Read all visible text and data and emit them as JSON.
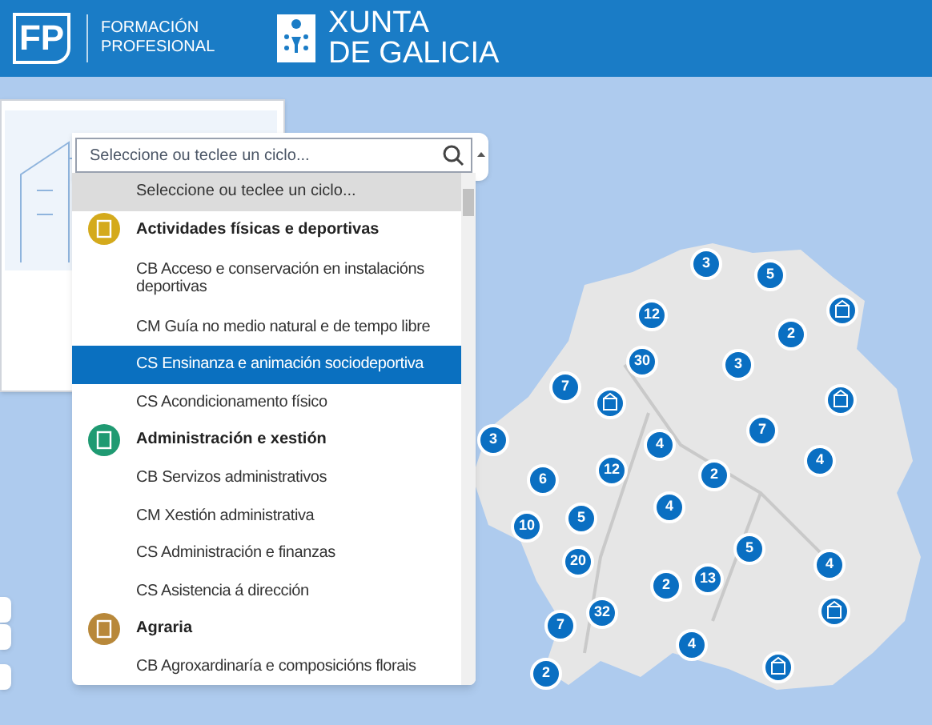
{
  "header": {
    "fp_logo": "FP",
    "fp_text": "FORMACIÓN PROFESIONAL",
    "xunta_line1": "XUNTA",
    "xunta_line2": "DE GALICIA"
  },
  "search": {
    "placeholder": "Seleccione ou teclee un ciclo..."
  },
  "options": [
    {
      "kind": "placeholder",
      "label": "Seleccione ou teclee un ciclo...",
      "selected": false
    },
    {
      "kind": "family",
      "label": "Actividades físicas e deportivas",
      "color": "#d4aa1c"
    },
    {
      "kind": "cycle",
      "label": "CB Acceso e conservación en instalacións deportivas",
      "selected": false
    },
    {
      "kind": "cycle",
      "label": "CM Guía no medio natural e de tempo libre",
      "selected": false
    },
    {
      "kind": "cycle",
      "label": "CS Ensinanza e animación sociodeportiva",
      "selected": true
    },
    {
      "kind": "cycle",
      "label": "CS Acondicionamento físico",
      "selected": false
    },
    {
      "kind": "family",
      "label": "Administración e xestión",
      "color": "#1f9a72"
    },
    {
      "kind": "cycle",
      "label": "CB Servizos administrativos",
      "selected": false
    },
    {
      "kind": "cycle",
      "label": "CM Xestión administrativa",
      "selected": false
    },
    {
      "kind": "cycle",
      "label": "CS Administración e finanzas",
      "selected": false
    },
    {
      "kind": "cycle",
      "label": "CS Asistencia á dirección",
      "selected": false
    },
    {
      "kind": "family",
      "label": "Agraria",
      "color": "#b8883a"
    },
    {
      "kind": "cycle",
      "label": "CB Agroxardinaría e composicións florais",
      "selected": false
    }
  ],
  "markers": [
    {
      "kind": "cluster",
      "count": "3"
    },
    {
      "kind": "cluster",
      "count": "5"
    },
    {
      "kind": "cluster",
      "count": "12"
    },
    {
      "kind": "center"
    },
    {
      "kind": "cluster",
      "count": "2"
    },
    {
      "kind": "cluster",
      "count": "30"
    },
    {
      "kind": "cluster",
      "count": "3"
    },
    {
      "kind": "cluster",
      "count": "7"
    },
    {
      "kind": "center"
    },
    {
      "kind": "center"
    },
    {
      "kind": "cluster",
      "count": "3"
    },
    {
      "kind": "cluster",
      "count": "4"
    },
    {
      "kind": "cluster",
      "count": "7"
    },
    {
      "kind": "cluster",
      "count": "4"
    },
    {
      "kind": "cluster",
      "count": "12"
    },
    {
      "kind": "cluster",
      "count": "6"
    },
    {
      "kind": "cluster",
      "count": "2"
    },
    {
      "kind": "cluster",
      "count": "5"
    },
    {
      "kind": "cluster",
      "count": "4"
    },
    {
      "kind": "cluster",
      "count": "10"
    },
    {
      "kind": "cluster",
      "count": "20"
    },
    {
      "kind": "cluster",
      "count": "5"
    },
    {
      "kind": "cluster",
      "count": "4"
    },
    {
      "kind": "cluster",
      "count": "2"
    },
    {
      "kind": "cluster",
      "count": "13"
    },
    {
      "kind": "cluster",
      "count": "32"
    },
    {
      "kind": "center"
    },
    {
      "kind": "cluster",
      "count": "7"
    },
    {
      "kind": "cluster",
      "count": "4"
    },
    {
      "kind": "center"
    },
    {
      "kind": "cluster",
      "count": "2"
    }
  ]
}
